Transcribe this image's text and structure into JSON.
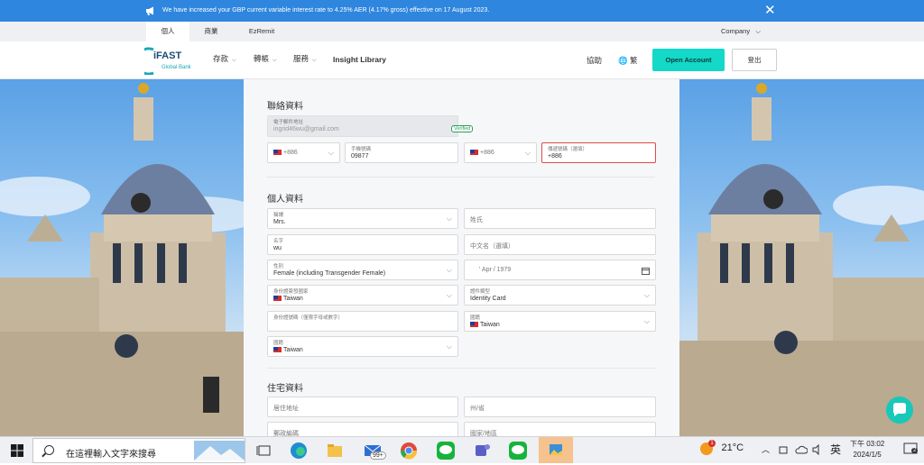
{
  "banner": {
    "message": "We have increased your GBP current variable interest rate to 4.25% AER (4.17% gross) effective on 17 August 2023.",
    "close_symbol": "✕"
  },
  "subnav": {
    "tabs": [
      {
        "label": "個人",
        "active": true
      },
      {
        "label": "商業",
        "active": false
      },
      {
        "label": "EzRemit",
        "active": false
      }
    ],
    "company_label": "Company"
  },
  "mainnav": {
    "logo_text": "iFAST",
    "logo_sub": "Global Bank",
    "items": [
      "存款",
      "轉帳",
      "服務"
    ],
    "insight": "Insight Library",
    "help": "協助",
    "lang": "繁",
    "open_account": "Open Account",
    "logout": "登出"
  },
  "form": {
    "contact": {
      "title": "聯絡資料",
      "email_label": "電子郵件地址",
      "email_value": "ingrid46wu@gmail.com",
      "verified": "Verified",
      "phone_code": "+886",
      "mobile_label": "手機號碼",
      "mobile_value": "09877",
      "fax_code": "+886",
      "fax_label": "傳遞號碼（選填）",
      "fax_value": "+886"
    },
    "personal": {
      "title": "個人資料",
      "salutation_label": "稱謂",
      "salutation_value": "Mrs.",
      "surname_ph": "姓氏",
      "given_label": "名字",
      "given_value": "wu",
      "chinese_ph": "中文名（選填）",
      "gender_label": "性別",
      "gender_value": "Female (including Transgender Female)",
      "dob_value": "' Apr / 1979",
      "id_country_label": "身份證簽發國家",
      "id_country_value": "Taiwan",
      "id_type_label": "證件類型",
      "id_type_value": "Identity Card",
      "id_number_label": "身份證號碼（僅限字母或數字）",
      "nationality_label": "國籍",
      "nationality_value": "Taiwan",
      "birth_country_label": "國籍",
      "birth_country_value": "Taiwan"
    },
    "residential": {
      "title": "住宅資料",
      "address_ph": "居住地址",
      "state_ph": "州/省",
      "postal_ph": "郵政編碼",
      "country_ph": "國家/地區"
    }
  },
  "taskbar": {
    "search_placeholder": "在這裡輸入文字來搜尋",
    "mail_badge": "99+",
    "weather_badge": "1",
    "temperature": "21°C",
    "ime": "英",
    "time": "下午 03:02",
    "date": "2024/1/5",
    "notification_count": "2"
  },
  "colors": {
    "banner": "#2e86de",
    "accent": "#14d8c8",
    "error": "#e04848",
    "verified": "#2b9e5a"
  }
}
